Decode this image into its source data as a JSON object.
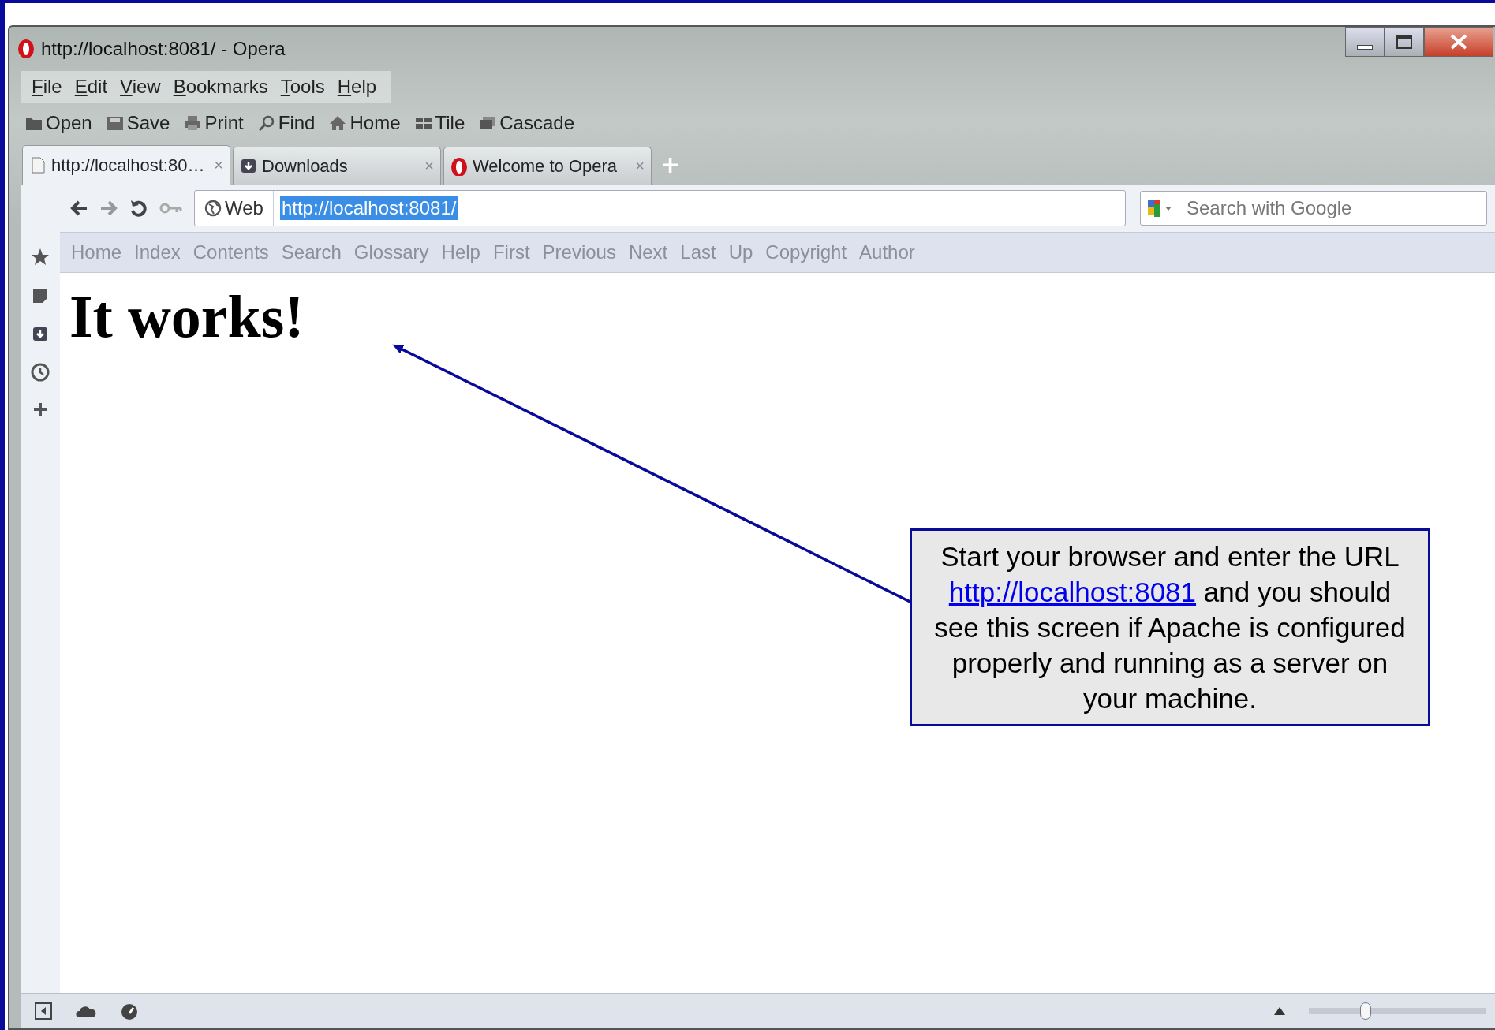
{
  "window": {
    "title": "http://localhost:8081/ - Opera"
  },
  "menu": [
    {
      "label": "File"
    },
    {
      "label": "Edit"
    },
    {
      "label": "View"
    },
    {
      "label": "Bookmarks"
    },
    {
      "label": "Tools"
    },
    {
      "label": "Help"
    }
  ],
  "toolbar": [
    {
      "label": "Open"
    },
    {
      "label": "Save"
    },
    {
      "label": "Print"
    },
    {
      "label": "Find"
    },
    {
      "label": "Home"
    },
    {
      "label": "Tile"
    },
    {
      "label": "Cascade"
    }
  ],
  "tabs": [
    {
      "label": "http://localhost:80…",
      "close": "×",
      "selected": true
    },
    {
      "label": "Downloads",
      "close": "×",
      "selected": false
    },
    {
      "label": "Welcome to Opera",
      "close": "×",
      "selected": false
    }
  ],
  "new_tab": "+",
  "address_bar": {
    "scope": "Web",
    "url": "http://localhost:8081/",
    "url_selected": true
  },
  "search": {
    "placeholder": "Search with Google"
  },
  "nav_links": [
    "Home",
    "Index",
    "Contents",
    "Search",
    "Glossary",
    "Help",
    "First",
    "Previous",
    "Next",
    "Last",
    "Up",
    "Copyright",
    "Author"
  ],
  "page": {
    "heading": "It works!"
  },
  "callout": {
    "text_before": "Start your browser and enter the URL ",
    "link": "http://localhost:8081",
    "text_after": " and you should see this screen if Apache is configured properly and running as a server on your machine."
  },
  "status_bar": {
    "zoom": {
      "level": 0.31
    }
  }
}
